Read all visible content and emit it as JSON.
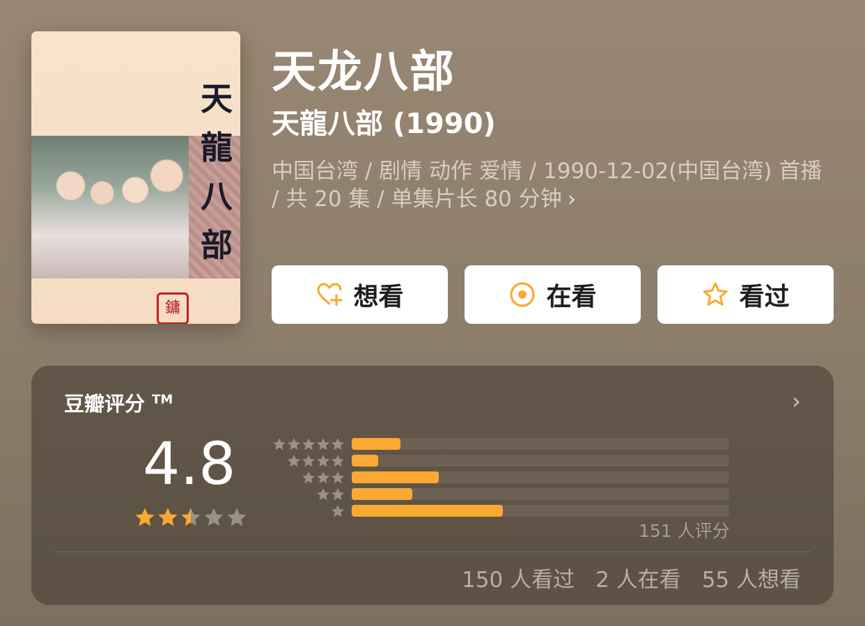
{
  "poster": {
    "vertical_title": "天龍八部",
    "seal_text": "鏞"
  },
  "title": "天龙八部",
  "subtitle": "天龍八部 (1990)",
  "meta": {
    "text": "中国台湾 / 剧情 动作 爱情 / 1990-12-02(中国台湾) 首播 / 共 20 集 / 单集片长 80 分钟"
  },
  "buttons": {
    "want": "想看",
    "doing": "在看",
    "done": "看过"
  },
  "rating": {
    "label": "豆瓣评分",
    "tm": "TM",
    "score": "4.8",
    "stars": 2.5,
    "raters": "151 人评分",
    "distribution": [
      {
        "stars": 5,
        "fraction": 0.13
      },
      {
        "stars": 4,
        "fraction": 0.07
      },
      {
        "stars": 3,
        "fraction": 0.23
      },
      {
        "stars": 2,
        "fraction": 0.16
      },
      {
        "stars": 1,
        "fraction": 0.4
      }
    ]
  },
  "stats": {
    "watched": "150 人看过",
    "watching": "2 人在看",
    "want": "55 人想看"
  },
  "colors": {
    "accent": "#fba932",
    "star_inactive": "#9a9087",
    "button_bg": "#ffffff"
  }
}
